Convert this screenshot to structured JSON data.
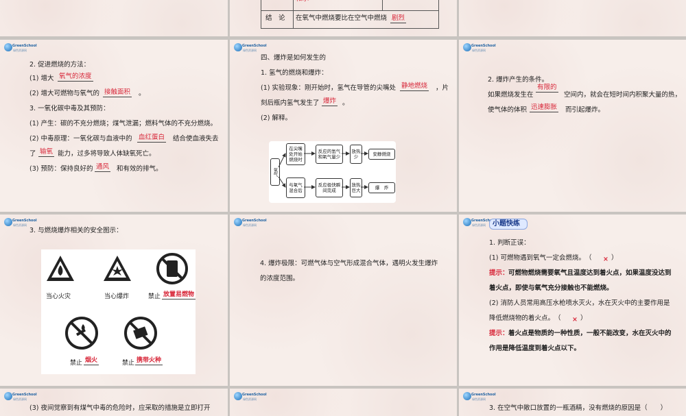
{
  "logo": {
    "name": "GreenSchool",
    "sub": "绿色资源网"
  },
  "slide_top_middle": {
    "row1_tail": "和水",
    "conclusion_label": "结　论",
    "conclusion_text": "在氧气中燃烧要比在空气中燃烧",
    "conclusion_fill": "剧烈"
  },
  "slide1": {
    "l1": "2. 促进燃烧的方法：",
    "l2a": "(1) 增大",
    "l2f": "氧气的浓度",
    "l3a": "(2) 增大可燃物与氧气的",
    "l3f": "接触面积",
    "l3b": "。",
    "l4": "3. 一氧化碳中毒及其预防：",
    "l5": "(1) 产生：碳的不充分燃烧；煤气泄漏；燃料气体的不充分燃烧。",
    "l6a": "(2) 中毒原理：一氧化碳与血液中的",
    "l6f": "血红蛋白",
    "l6b": "结合使血液失去",
    "l7a": "了",
    "l7f": "输氧",
    "l7b": "能力，过多将导致人体缺氧死亡。",
    "l8a": "(3) 预防：保持良好的",
    "l8f": "通风",
    "l8b": "和有效的排气。"
  },
  "slide2": {
    "l1": "四、爆炸是如何发生的",
    "l2": "1. 氢气的燃烧和爆炸：",
    "l3a": "(1) 实验现象：刚开始时，氢气在导管的尖嘴处",
    "l3f": "静地燃烧",
    "l3b": "，片",
    "l4a": "刻后瓶内氢气发生了",
    "l4f": "爆炸",
    "l4b": "。",
    "l5": "(2) 解释。",
    "diagram": {
      "root": "氢气",
      "b1": "在尖嘴处开始燃烧时",
      "b2": "反应的氢气和氧气量少",
      "b3": "放热少",
      "b4": "安静燃烧",
      "c1": "与氧气混合后",
      "c2": "反应极快瞬间完成",
      "c3": "放热巨大",
      "c4": "爆　炸"
    }
  },
  "slide3": {
    "l1": "2. 爆炸产生的条件。",
    "l2a": "如果燃烧发生在",
    "l2f": "有限的",
    "l2b": "空间内，就会在短时间内积聚大量的热，",
    "l3a": "使气体的体积",
    "l3f": "迅速膨胀",
    "l3b": "而引起爆炸。"
  },
  "slide4": {
    "l1": "3. 与燃烧爆炸相关的安全图示：",
    "signs": [
      {
        "label": "当心火灾"
      },
      {
        "label": "当心爆炸"
      },
      {
        "label": "禁止",
        "fill": "放置易燃物"
      },
      {
        "label": "禁止",
        "fill": "烟火"
      },
      {
        "label": "禁止",
        "fill": "携带火种"
      }
    ]
  },
  "slide5": {
    "l1": "4. 爆炸极限：可燃气体与空气形成混合气体，遇明火发生爆炸",
    "l2": "的浓度范围。"
  },
  "slide6": {
    "badge": "小题快练",
    "l1": "1. 判断正误：",
    "l2": "(1) 可燃物遇到氧气一定会燃烧。　（",
    "l2x": "×",
    "l2e": "）",
    "h1a": "提示：",
    "h1b": "可燃物燃烧需要氧气且温度达到着火点，如果温度没达到",
    "h1c": "着火点，即使与氧气充分接触也不能燃烧。",
    "l3": "(2) 消防人员常用高压水枪喷水灭火，水在灭火中的主要作用是",
    "l4": "降低燃烧物的着火点。　（",
    "l4x": "×",
    "l4e": "）",
    "h2a": "提示：",
    "h2b": "着火点是物质的一种性质，一般不能改变，水在灭火中的",
    "h2c": "作用是降低温度到着火点以下。"
  },
  "slide7": {
    "l1": "(3) 夜间觉察到有煤气中毒的危险时，应采取的措施是立即打开"
  },
  "slide9": {
    "l1": "3. 在空气中敞口放置的一瓶酒精，没有燃烧的原因是（　　）"
  }
}
